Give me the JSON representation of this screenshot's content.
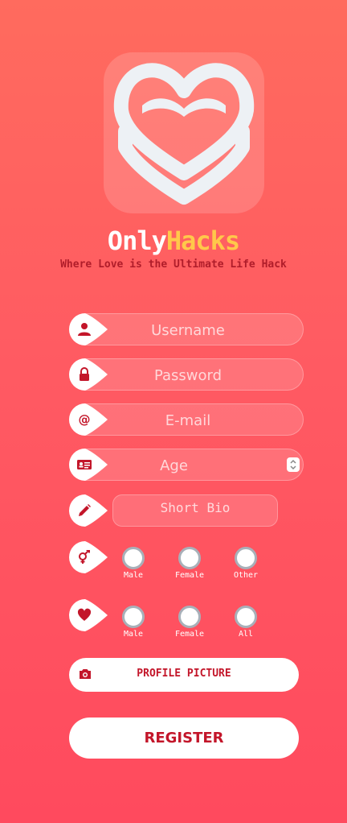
{
  "brand": {
    "name_part1": "Only",
    "name_part2": "Hacks",
    "tagline": "Where Love is the Ultimate Life Hack",
    "logo_icon": "heart-logo"
  },
  "form": {
    "username_placeholder": "Username",
    "password_placeholder": "Password",
    "email_placeholder": "E-mail",
    "age_placeholder": "Age",
    "bio_placeholder": "Short Bio",
    "gender": {
      "icon": "gender-icon",
      "options": [
        "Male",
        "Female",
        "Other"
      ]
    },
    "interest": {
      "icon": "heart-icon",
      "options": [
        "Male",
        "Female",
        "All"
      ]
    },
    "profile_picture_label": "PROFILE PICTURE",
    "register_label": "REGISTER"
  },
  "colors": {
    "accent_red": "#c3162a",
    "brand_yellow": "#ffc84a",
    "tagline_red": "#b01d2a"
  }
}
